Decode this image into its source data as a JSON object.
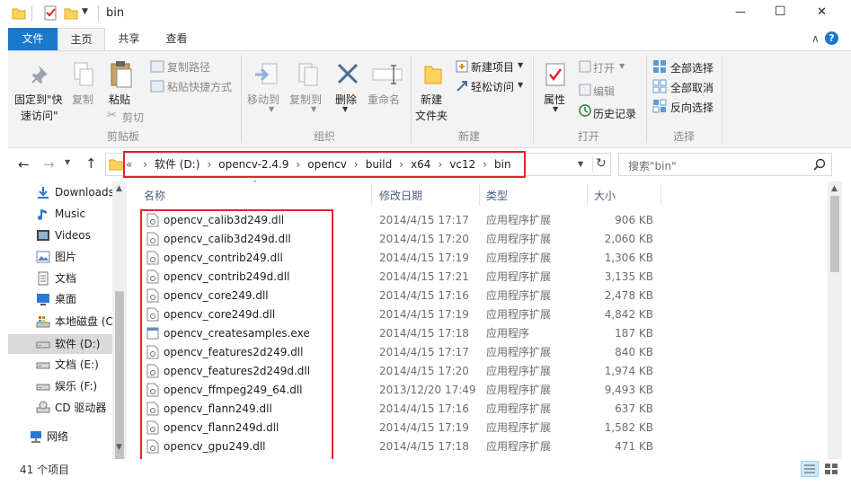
{
  "window": {
    "title": "bin",
    "min_glyph": "—",
    "max_glyph": "☐",
    "close_glyph": "✕",
    "help_glyph": "?",
    "collapse_glyph": "∧"
  },
  "tabs": [
    {
      "label": "文件",
      "active": true
    },
    {
      "label": "主页",
      "selected": true
    },
    {
      "label": "共享"
    },
    {
      "label": "查看"
    }
  ],
  "ribbon": {
    "clipboard": {
      "pin_label_1": "固定到\"快",
      "pin_label_2": "速访问\"",
      "copy": "复制",
      "paste": "粘贴",
      "copy_path": "复制路径",
      "paste_shortcut": "粘贴快捷方式",
      "cut": "剪切",
      "group": "剪贴板"
    },
    "organize": {
      "move_to": "移动到",
      "copy_to": "复制到",
      "delete": "删除",
      "rename": "重命名",
      "group": "组织"
    },
    "new": {
      "new_folder_1": "新建",
      "new_folder_2": "文件夹",
      "new_item": "新建项目",
      "easy_access": "轻松访问",
      "group": "新建"
    },
    "open": {
      "properties": "属性",
      "open": "打开",
      "edit": "编辑",
      "history": "历史记录",
      "group": "打开"
    },
    "select": {
      "select_all": "全部选择",
      "select_none": "全部取消",
      "invert": "反向选择",
      "group": "选择"
    }
  },
  "address": {
    "prefix": "«",
    "crumbs": [
      "软件 (D:)",
      "opencv-2.4.9",
      "opencv",
      "build",
      "x64",
      "vc12",
      "bin"
    ],
    "separator": "›",
    "search_placeholder": "搜索\"bin\""
  },
  "nav": [
    {
      "label": "Downloads",
      "icon": "download-icon"
    },
    {
      "label": "Music",
      "icon": "music-icon"
    },
    {
      "label": "Videos",
      "icon": "video-icon"
    },
    {
      "label": "图片",
      "icon": "pictures-icon"
    },
    {
      "label": "文档",
      "icon": "documents-icon"
    },
    {
      "label": "桌面",
      "icon": "desktop-icon"
    },
    {
      "label": "本地磁盘 (C",
      "icon": "local-disk-icon"
    },
    {
      "label": "软件 (D:)",
      "icon": "drive-icon",
      "selected": true
    },
    {
      "label": "文档 (E:)",
      "icon": "drive-icon"
    },
    {
      "label": "娱乐 (F:)",
      "icon": "drive-icon"
    },
    {
      "label": "CD 驱动器",
      "icon": "cd-drive-icon"
    },
    {
      "label": "网络",
      "icon": "network-icon"
    }
  ],
  "columns": {
    "name": "名称",
    "modified": "修改日期",
    "type": "类型",
    "size": "大小"
  },
  "files": [
    {
      "name": "opencv_calib3d249.dll",
      "modified": "2014/4/15 17:17",
      "type": "应用程序扩展",
      "size": "906 KB"
    },
    {
      "name": "opencv_calib3d249d.dll",
      "modified": "2014/4/15 17:20",
      "type": "应用程序扩展",
      "size": "2,060 KB"
    },
    {
      "name": "opencv_contrib249.dll",
      "modified": "2014/4/15 17:19",
      "type": "应用程序扩展",
      "size": "1,306 KB"
    },
    {
      "name": "opencv_contrib249d.dll",
      "modified": "2014/4/15 17:21",
      "type": "应用程序扩展",
      "size": "3,135 KB"
    },
    {
      "name": "opencv_core249.dll",
      "modified": "2014/4/15 17:16",
      "type": "应用程序扩展",
      "size": "2,478 KB"
    },
    {
      "name": "opencv_core249d.dll",
      "modified": "2014/4/15 17:19",
      "type": "应用程序扩展",
      "size": "4,842 KB"
    },
    {
      "name": "opencv_createsamples.exe",
      "modified": "2014/4/15 17:18",
      "type": "应用程序",
      "size": "187 KB"
    },
    {
      "name": "opencv_features2d249.dll",
      "modified": "2014/4/15 17:17",
      "type": "应用程序扩展",
      "size": "840 KB"
    },
    {
      "name": "opencv_features2d249d.dll",
      "modified": "2014/4/15 17:20",
      "type": "应用程序扩展",
      "size": "1,974 KB"
    },
    {
      "name": "opencv_ffmpeg249_64.dll",
      "modified": "2013/12/20 17:49",
      "type": "应用程序扩展",
      "size": "9,493 KB"
    },
    {
      "name": "opencv_flann249.dll",
      "modified": "2014/4/15 17:16",
      "type": "应用程序扩展",
      "size": "637 KB"
    },
    {
      "name": "opencv_flann249d.dll",
      "modified": "2014/4/15 17:19",
      "type": "应用程序扩展",
      "size": "1,582 KB"
    },
    {
      "name": "opencv_gpu249.dll",
      "modified": "2014/4/15 17:18",
      "type": "应用程序扩展",
      "size": "471 KB"
    }
  ],
  "status": {
    "item_count": "41 个项目"
  },
  "colors": {
    "file_tab": "#1979ca",
    "highlight": "#e0252b",
    "selected_nav": "#cce8ff",
    "header_text": "#4c607a"
  }
}
